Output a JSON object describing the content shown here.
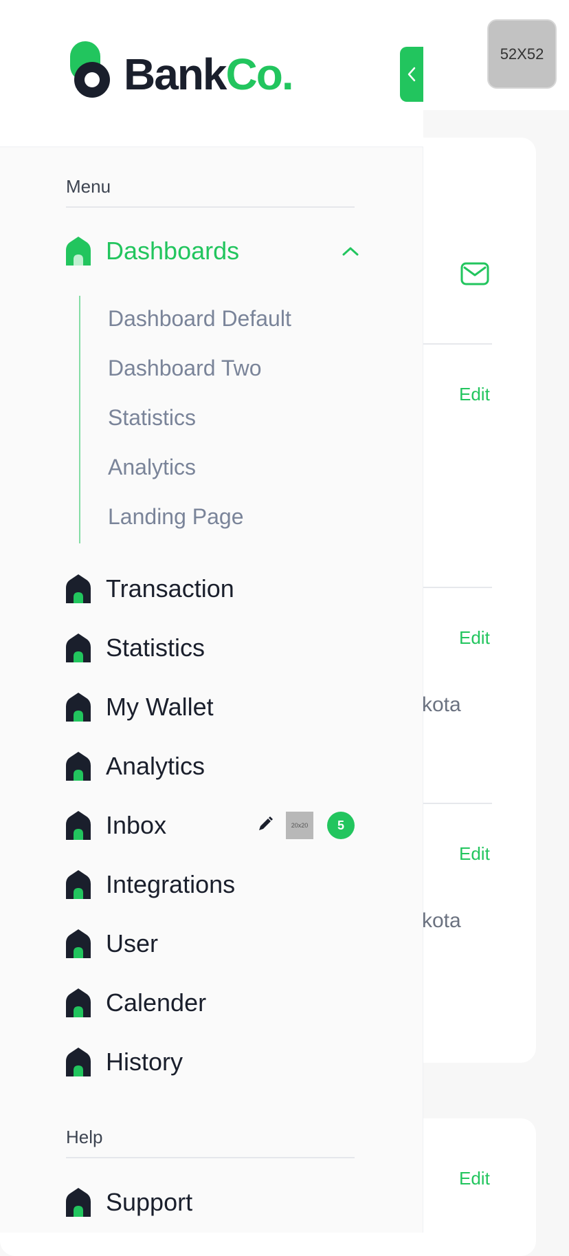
{
  "topbar": {
    "avatar_placeholder": "52X52"
  },
  "content": {
    "edit_label": "Edit",
    "city_fragment_1": "kota",
    "city_fragment_2": "kota"
  },
  "brand": {
    "name_dark": "Bank",
    "name_green": "Co."
  },
  "sidebar": {
    "menu_label": "Menu",
    "dashboards": {
      "label": "Dashboards",
      "expanded": true,
      "items": [
        "Dashboard Default",
        "Dashboard Two",
        "Statistics",
        "Analytics",
        "Landing Page"
      ]
    },
    "items": [
      {
        "label": "Transaction"
      },
      {
        "label": "Statistics"
      },
      {
        "label": "My Wallet"
      },
      {
        "label": "Analytics"
      },
      {
        "label": "Inbox",
        "image_placeholder": "20x20",
        "badge_count": "5"
      },
      {
        "label": "Integrations"
      },
      {
        "label": "User"
      },
      {
        "label": "Calender"
      },
      {
        "label": "History"
      }
    ],
    "help_label": "Help",
    "help_items": [
      {
        "label": "Support"
      }
    ]
  },
  "colors": {
    "accent": "#22c55e",
    "dark": "#1a1f2c",
    "muted": "#7a8499"
  },
  "icons": {
    "nav": "house-icon",
    "mail": "mail-icon",
    "collapse": "chevron-left-icon",
    "expand": "chevron-up-icon",
    "edit": "pencil-icon"
  }
}
